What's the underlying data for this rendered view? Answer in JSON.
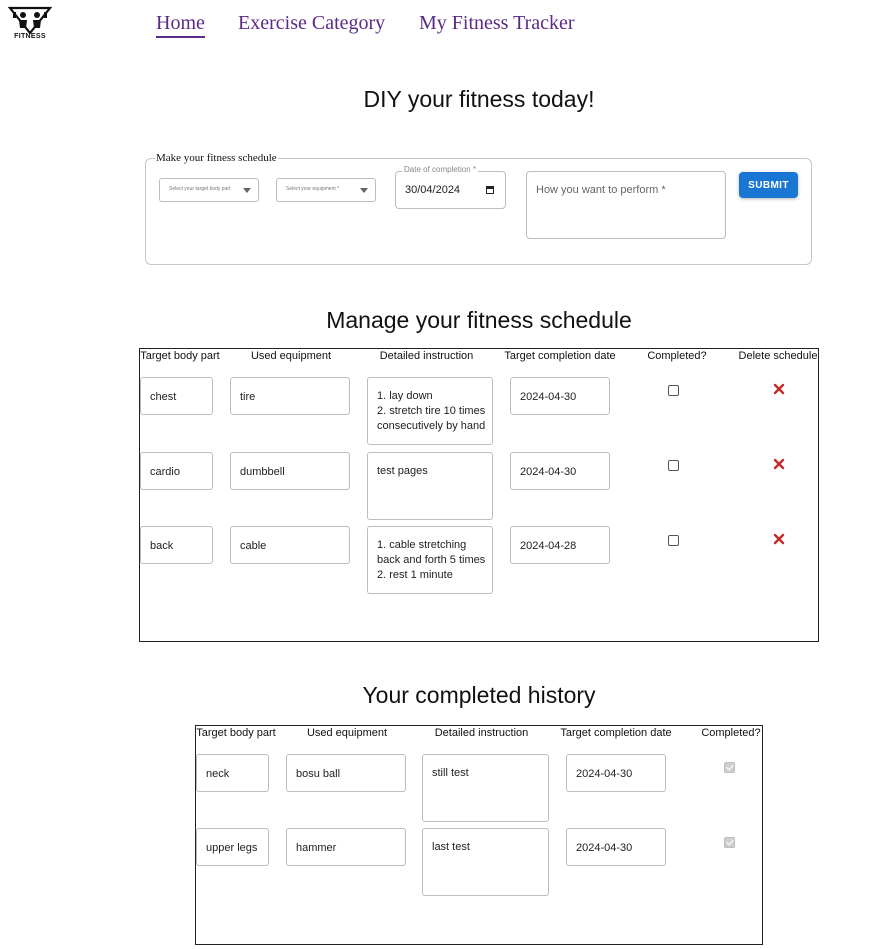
{
  "brand": {
    "logo_text": "FITNESS"
  },
  "nav": {
    "items": [
      {
        "label": "Home",
        "active": true
      },
      {
        "label": "Exercise Category",
        "active": false
      },
      {
        "label": "My Fitness Tracker",
        "active": false
      }
    ]
  },
  "hero": {
    "title": "DIY your fitness today!"
  },
  "form": {
    "legend": "Make your fitness schedule",
    "body_part_placeholder": "Select your target body part",
    "equipment_placeholder": "Select your equipment *",
    "date_label": "Date of completion *",
    "date_value": "30/04/2024",
    "instruction_placeholder": "How you want to perform *",
    "submit_label": "SUBMIT"
  },
  "manage": {
    "title": "Manage your fitness schedule",
    "columns": [
      "Target body part",
      "Used equipment",
      "Detailed instruction",
      "Target completion date",
      "Completed?",
      "Delete schedule"
    ],
    "rows": [
      {
        "body_part": "chest",
        "equipment": "tire",
        "instruction": "1. lay down\n2. stretch tire 10 times consecutively by hand",
        "date": "2024-04-30",
        "completed": false
      },
      {
        "body_part": "cardio",
        "equipment": "dumbbell",
        "instruction": "test pages",
        "date": "2024-04-30",
        "completed": false
      },
      {
        "body_part": "back",
        "equipment": "cable",
        "instruction": "1. cable stretching back and forth 5 times\n2. rest 1 minute",
        "date": "2024-04-28",
        "completed": false
      }
    ]
  },
  "history": {
    "title": "Your completed history",
    "columns": [
      "Target body part",
      "Used equipment",
      "Detailed instruction",
      "Target completion date",
      "Completed?"
    ],
    "rows": [
      {
        "body_part": "neck",
        "equipment": "bosu ball",
        "instruction": "still test",
        "date": "2024-04-30",
        "completed": true
      },
      {
        "body_part": "upper legs",
        "equipment": "hammer",
        "instruction": "last test",
        "date": "2024-04-30",
        "completed": true
      }
    ]
  },
  "colors": {
    "nav": "#5b2a86",
    "submit": "#1976d2",
    "delete": "#c62828"
  }
}
